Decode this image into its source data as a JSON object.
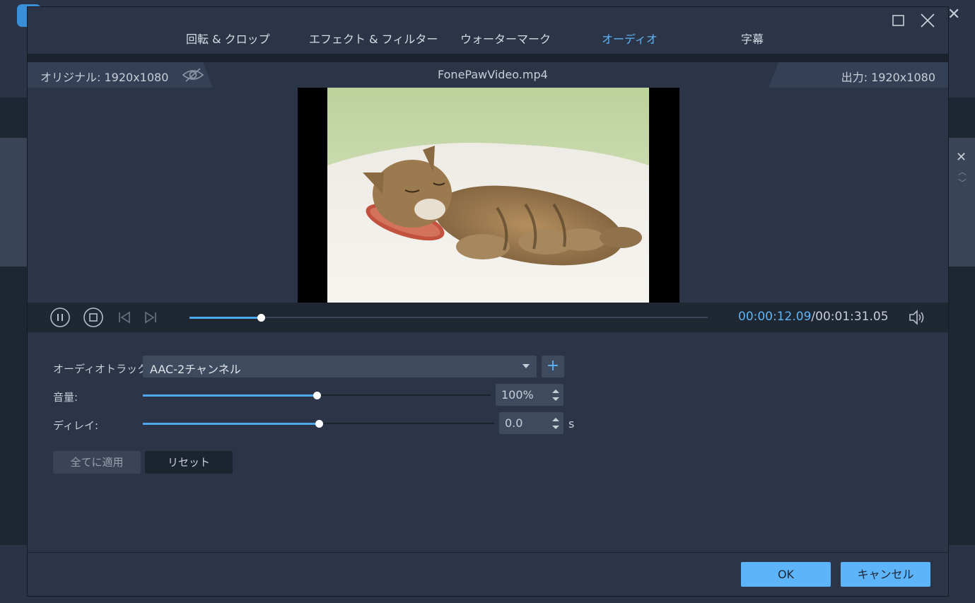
{
  "dialog": {
    "tabs": [
      {
        "label": "回転 & クロップ",
        "active": false
      },
      {
        "label": "エフェクト & フィルター",
        "active": false
      },
      {
        "label": "ウォーターマーク",
        "active": false
      },
      {
        "label": "オーディオ",
        "active": true
      },
      {
        "label": "字幕",
        "active": false
      }
    ],
    "window_buttons": {
      "maximize": "maximize-icon",
      "close": "close-icon"
    }
  },
  "info_bar": {
    "original": "オリジナル: 1920x1080",
    "filename": "FonePawVideo.mp4",
    "output": "出力: 1920x1080"
  },
  "preview": {
    "description": "sleeping-kitten-on-pillow"
  },
  "player": {
    "current_time": "00:00:12.09",
    "separator": "/",
    "total_time": "00:01:31.05",
    "progress": 0.138
  },
  "audio": {
    "track_label": "オーディオトラック:",
    "track_value": "AAC-2チャンネル",
    "add_label": "+",
    "volume_label": "音量:",
    "volume_value": "100%",
    "volume_level": 0.5,
    "delay_label": "ディレイ:",
    "delay_value": "0.0",
    "delay_unit": "s",
    "delay_level": 0.5,
    "apply_all": "全てに適用",
    "reset": "リセット"
  },
  "footer": {
    "ok": "OK",
    "cancel": "キャンセル"
  },
  "colors": {
    "accent": "#5fb3f5",
    "dialog_bg": "#2b3547",
    "primary_button": "#5db4f8"
  }
}
